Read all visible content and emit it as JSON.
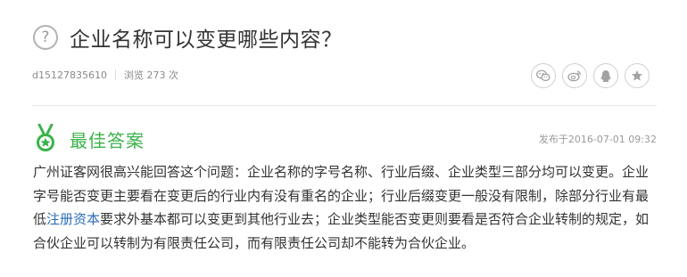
{
  "question": {
    "icon": "question-circle-icon",
    "icon_glyph": "?",
    "title": "企业名称可以变更哪些内容？"
  },
  "meta": {
    "user": "d15127835610",
    "views": "浏览 273 次"
  },
  "share": {
    "buttons": [
      {
        "name": "wechat-icon"
      },
      {
        "name": "weibo-icon"
      },
      {
        "name": "qq-icon"
      },
      {
        "name": "favorite-star-icon"
      }
    ]
  },
  "answer": {
    "label": "最佳答案",
    "published": "发布于2016-07-01 09:32",
    "text_part1": "广州证客网很高兴能回答这个问题：企业名称的字号名称、行业后缀、企业类型三部分均可以变更。企业字号能否变更主要看在变更后的行业内有没有重名的企业；行业后缀变更一般没有限制，除部分行业有最低",
    "link_text": "注册资本",
    "text_part2": "要求外基本都可以变更到其他行业去；企业类型能否变更则要看是否符合企业转制的规定，如合伙企业可以转制为有限责任公司，而有限责任公司却不能转为合伙企业。"
  },
  "colors": {
    "accent_green": "#3bb24a",
    "link_blue": "#2b6cb7",
    "text": "#333333",
    "muted": "#8a8a8a"
  }
}
